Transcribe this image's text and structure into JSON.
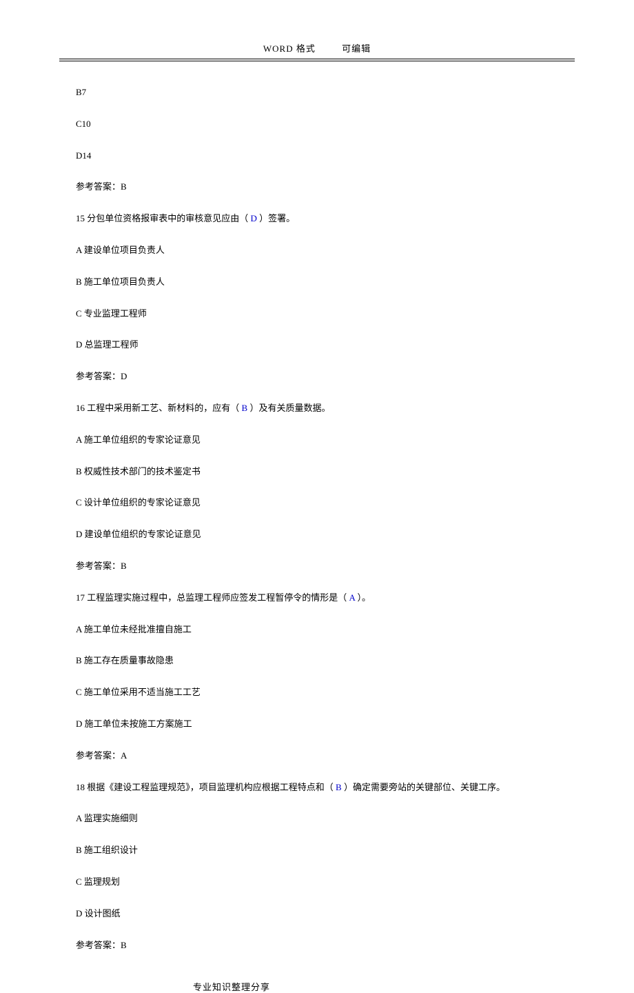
{
  "header": {
    "left": "WORD 格式",
    "right": "可编辑"
  },
  "lines": {
    "l1": "B7",
    "l2": "C10",
    "l3": "D14",
    "l4": "参考答案：B",
    "l5a": "15 分包单位资格报审表中的审核意见应由（  ",
    "l5b": "D",
    "l5c": "  ）签署。",
    "l6": "A 建设单位项目负责人",
    "l7": "B 施工单位项目负责人",
    "l8": "C 专业监理工程师",
    "l9": "D 总监理工程师",
    "l10": "参考答案：D",
    "l11a": "16 工程中采用新工艺、新材料的，应有（  ",
    "l11b": "B",
    "l11c": "    ）及有关质量数据。",
    "l12": "A 施工单位组织的专家论证意见",
    "l13": "B 权威性技术部门的技术鉴定书",
    "l14": "C 设计单位组织的专家论证意见",
    "l15": "D 建设单位组织的专家论证意见",
    "l16": "参考答案：B",
    "l17a": "17 工程监理实施过程中，总监理工程师应签发工程暂停令的情形是（  ",
    "l17b": "A",
    "l17c": "   ）。",
    "l18": "A 施工单位未经批准擅自施工",
    "l19": "B 施工存在质量事故隐患",
    "l20": "C 施工单位采用不适当施工工艺",
    "l21": "D 施工单位未按施工方案施工",
    "l22": "参考答案：A",
    "l23a": "18 根据《建设工程监理规范》，项目监理机构应根据工程特点和（   ",
    "l23b": "B",
    "l23c": "   ）确定需要旁站的关键部位、关键工序。",
    "l24": "A 监理实施细则",
    "l25": "B 施工组织设计",
    "l26": "C 监理规划",
    "l27": "D 设计图纸",
    "l28": "参考答案：B"
  },
  "footer": "专业知识整理分享"
}
